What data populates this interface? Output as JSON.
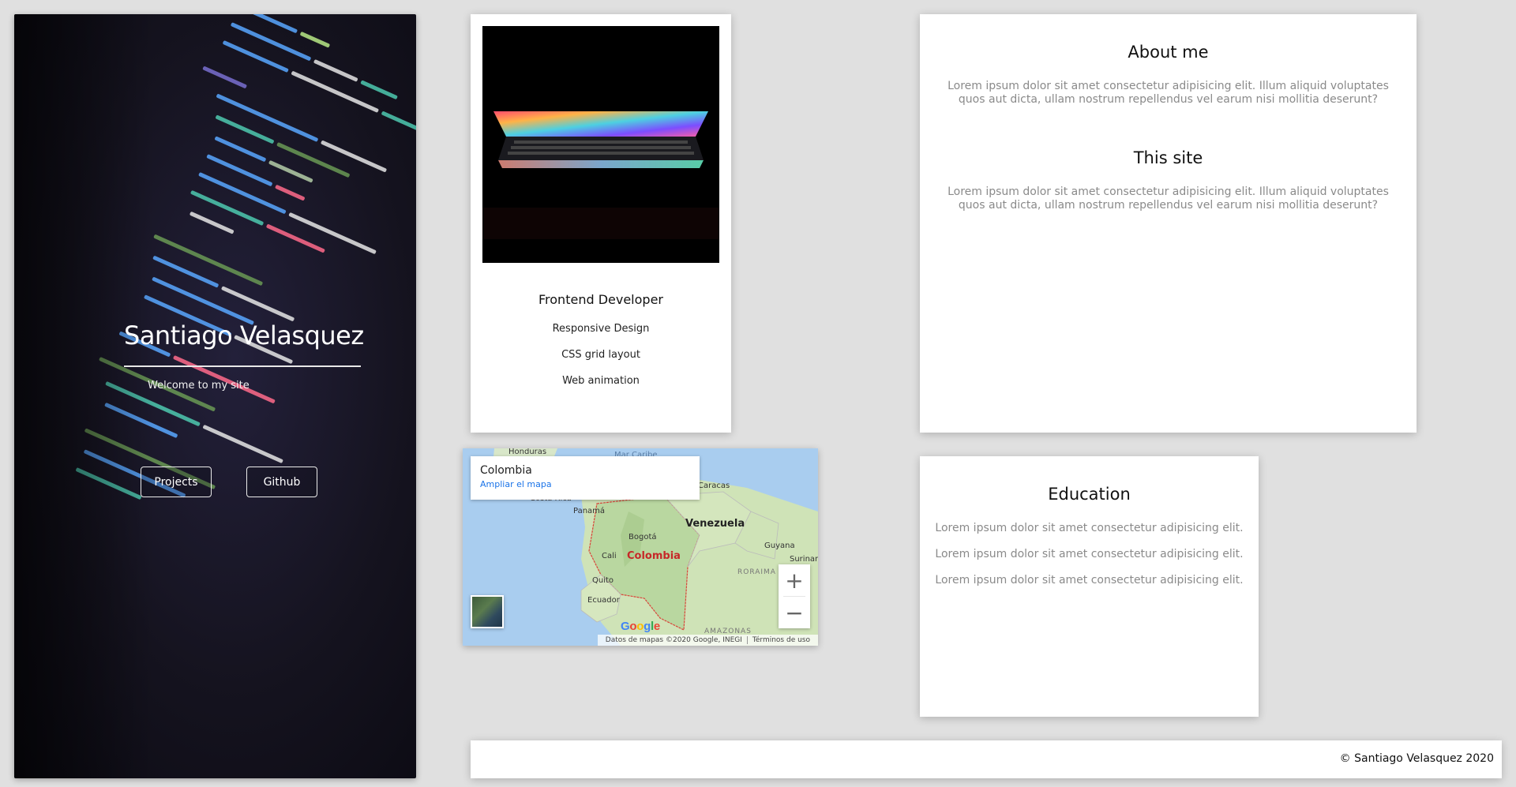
{
  "hero": {
    "name": "Santiago Velasquez",
    "welcome": "Welcome to my site",
    "buttons": {
      "projects": "Projects",
      "github": "Github"
    }
  },
  "profile": {
    "title": "Frontend Developer",
    "skills": [
      "Responsive Design",
      "CSS grid layout",
      "Web animation"
    ]
  },
  "map": {
    "place": "Colombia",
    "enlarge": "Ampliar el mapa",
    "labels": {
      "honduras": "Honduras",
      "mar_caribe": "Mar Caribe",
      "caracas": "Caracas",
      "costa_rica": "Costa Rica",
      "panama": "Panamá",
      "venezuela": "Venezuela",
      "bogota": "Bogotá",
      "cali": "Cali",
      "colombia": "Colombia",
      "guyana": "Guyana",
      "surinam": "Surinam",
      "roraima": "RORAIMA",
      "quito": "Quito",
      "ecuador": "Ecuador",
      "amazonas": "AMAZONAS"
    },
    "zoom_in": "+",
    "zoom_out": "−",
    "attribution": "Datos de mapas ©2020 Google, INEGI",
    "terms": "Términos de uso",
    "logo": "Google"
  },
  "about": {
    "heading": "About me",
    "text": "Lorem ipsum dolor sit amet consectetur adipisicing elit. Illum aliquid voluptates quos aut dicta, ullam nostrum repellendus vel earum nisi mollitia deserunt?"
  },
  "site": {
    "heading": "This site",
    "text": "Lorem ipsum dolor sit amet consectetur adipisicing elit. Illum aliquid voluptates quos aut dicta, ullam nostrum repellendus vel earum nisi mollitia deserunt?"
  },
  "education": {
    "heading": "Education",
    "items": [
      "Lorem ipsum dolor sit amet consectetur adipisicing elit.",
      "Lorem ipsum dolor sit amet consectetur adipisicing elit.",
      "Lorem ipsum dolor sit amet consectetur adipisicing elit."
    ]
  },
  "footer": {
    "text": "© Santiago Velasquez 2020"
  }
}
